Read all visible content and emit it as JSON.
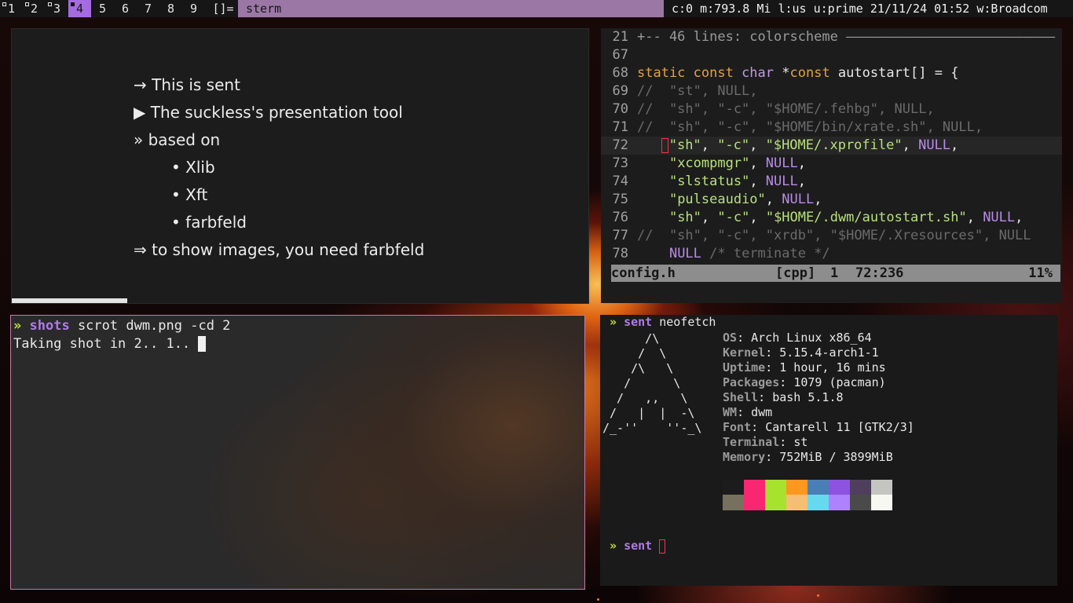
{
  "bar": {
    "tags": [
      {
        "label": "1",
        "occupied": true
      },
      {
        "label": "2",
        "occupied": true
      },
      {
        "label": "3",
        "occupied": true
      },
      {
        "label": "4",
        "occupied": true,
        "active": true
      },
      {
        "label": "5"
      },
      {
        "label": "6"
      },
      {
        "label": "7"
      },
      {
        "label": "8"
      },
      {
        "label": "9"
      }
    ],
    "layout": "[]=",
    "title": "sterm",
    "status": "c:0 m:793.8 Mi  l:us u:prime  21/11/24 01:52  w:Broadcom",
    "active_color": "#a46ce0",
    "title_color": "#9b77a6"
  },
  "sent": {
    "lines": [
      {
        "text": "→ This is sent",
        "indent": false
      },
      {
        "text": "▶ The suckless's presentation tool",
        "indent": false
      },
      {
        "text": "» based on",
        "indent": false
      },
      {
        "text": "• Xlib",
        "indent": true
      },
      {
        "text": "• Xft",
        "indent": true
      },
      {
        "text": "• farbfeld",
        "indent": true
      },
      {
        "text": "⇒ to show images, you need farbfeld",
        "indent": false
      }
    ],
    "progress": 0.2
  },
  "vim": {
    "lines": [
      {
        "n": "21",
        "parts": [
          [
            "fold",
            "+-- 46 lines: colorscheme ——————————————————————————"
          ]
        ]
      },
      {
        "n": "67",
        "parts": []
      },
      {
        "n": "68",
        "parts": [
          [
            "key",
            "static const "
          ],
          [
            "type",
            "char"
          ],
          [
            "plain",
            " *"
          ],
          [
            "key",
            "const"
          ],
          [
            "plain",
            " autostart[] = {"
          ]
        ]
      },
      {
        "n": "69",
        "parts": [
          [
            "com",
            "//  \"st\", NULL,"
          ]
        ]
      },
      {
        "n": "70",
        "parts": [
          [
            "com",
            "//  \"sh\", \"-c\", \"$HOME/.fehbg\", NULL,"
          ]
        ]
      },
      {
        "n": "71",
        "parts": [
          [
            "com",
            "//  \"sh\", \"-c\", \"$HOME/bin/xrate.sh\", NULL,"
          ]
        ]
      },
      {
        "n": "72",
        "cur": true,
        "parts": [
          [
            "plain",
            "   "
          ],
          [
            "cursor",
            ""
          ],
          [
            "str",
            "\"sh\""
          ],
          [
            "plain",
            ", "
          ],
          [
            "str",
            "\"-c\""
          ],
          [
            "plain",
            ", "
          ],
          [
            "str",
            "\"$HOME/.xprofile\""
          ],
          [
            "plain",
            ", "
          ],
          [
            "null",
            "NULL"
          ],
          [
            "plain",
            ","
          ]
        ]
      },
      {
        "n": "73",
        "parts": [
          [
            "plain",
            "    "
          ],
          [
            "str",
            "\"xcompmgr\""
          ],
          [
            "plain",
            ", "
          ],
          [
            "null",
            "NULL"
          ],
          [
            "plain",
            ","
          ]
        ]
      },
      {
        "n": "74",
        "parts": [
          [
            "plain",
            "    "
          ],
          [
            "str",
            "\"slstatus\""
          ],
          [
            "plain",
            ", "
          ],
          [
            "null",
            "NULL"
          ],
          [
            "plain",
            ","
          ]
        ]
      },
      {
        "n": "75",
        "parts": [
          [
            "plain",
            "    "
          ],
          [
            "str",
            "\"pulseaudio\""
          ],
          [
            "plain",
            ", "
          ],
          [
            "null",
            "NULL"
          ],
          [
            "plain",
            ","
          ]
        ]
      },
      {
        "n": "76",
        "parts": [
          [
            "plain",
            "    "
          ],
          [
            "str",
            "\"sh\""
          ],
          [
            "plain",
            ", "
          ],
          [
            "str",
            "\"-c\""
          ],
          [
            "plain",
            ", "
          ],
          [
            "str",
            "\"$HOME/.dwm/autostart.sh\""
          ],
          [
            "plain",
            ", "
          ],
          [
            "null",
            "NULL"
          ],
          [
            "plain",
            ","
          ]
        ]
      },
      {
        "n": "77",
        "parts": [
          [
            "com",
            "//  \"sh\", \"-c\", \"xrdb\", \"$HOME/.Xresources\", NULL"
          ]
        ]
      },
      {
        "n": "78",
        "parts": [
          [
            "plain",
            "    "
          ],
          [
            "null",
            "NULL"
          ],
          [
            "com",
            " /* terminate */"
          ]
        ]
      }
    ],
    "status": {
      "file": "config.h",
      "filetype": "[cpp]",
      "buffer": "1",
      "position": "72:236",
      "percent": "11%"
    }
  },
  "term": {
    "prompt_symbol": "»",
    "cwd": "shots",
    "command": "scrot dwm.png -cd 2",
    "output": "Taking shot in 2.. 1.. "
  },
  "neofetch": {
    "prompt_symbol": "»",
    "cwd": "sent",
    "command": "neofetch",
    "ascii": [
      "      /\\",
      "     /  \\",
      "    /\\   \\",
      "   /      \\",
      "  /   ,,   \\",
      " /   |  |  -\\",
      "/_-''    ''-_\\"
    ],
    "info": [
      {
        "label": "OS",
        "value": "Arch Linux x86_64"
      },
      {
        "label": "Kernel",
        "value": "5.15.4-arch1-1"
      },
      {
        "label": "Uptime",
        "value": "1 hour, 16 mins"
      },
      {
        "label": "Packages",
        "value": "1079 (pacman)"
      },
      {
        "label": "Shell",
        "value": "bash 5.1.8"
      },
      {
        "label": "WM",
        "value": "dwm"
      },
      {
        "label": "Font",
        "value": "Cantarell 11 [GTK2/3]"
      },
      {
        "label": "Terminal",
        "value": "st"
      },
      {
        "label": "Memory",
        "value": "752MiB / 3899MiB"
      }
    ],
    "palette_top": [
      "#1c1c1c",
      "#f92672",
      "#a6e22e",
      "#fd971f",
      "#4a7fb5",
      "#8e52e0",
      "#4e3f5c",
      "#c4c4c0"
    ],
    "palette_bottom": [
      "#75715e",
      "#f92672",
      "#a6e22e",
      "#f4bf75",
      "#66d9ef",
      "#ae81ff",
      "#4a4a4a",
      "#f8f8f2"
    ]
  },
  "colors": {
    "accent": "#a46ce0",
    "prompt": "#c8e33a",
    "string": "#b7e17a",
    "keyword": "#e4a23b",
    "border": "#c97aa5"
  }
}
